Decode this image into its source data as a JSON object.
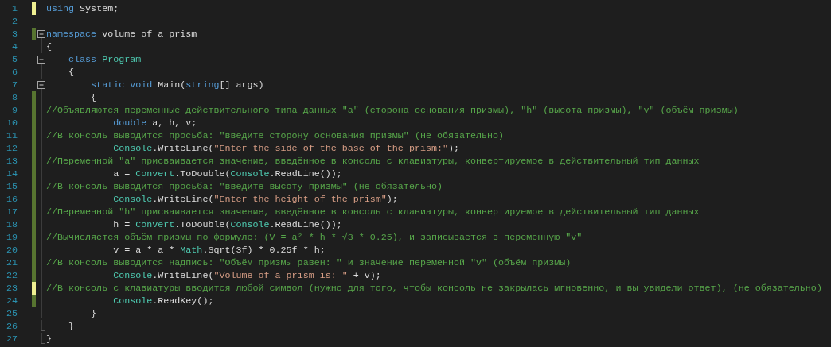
{
  "editor": {
    "lines": [
      {
        "number": "1",
        "color": "#efef91",
        "fold_start": false,
        "fold_end": false,
        "tokens": [
          {
            "kind": "keyword",
            "text": "using"
          },
          {
            "kind": "plain",
            "text": " System;"
          }
        ]
      },
      {
        "number": "2",
        "fold_start": false,
        "fold_end": false
      },
      {
        "number": "3",
        "color": "#577430",
        "fold_start": true,
        "fold_end": false,
        "tokens": [
          {
            "kind": "keyword",
            "text": "namespace"
          },
          {
            "kind": "plain",
            "text": " volume_of_a_prism"
          }
        ]
      },
      {
        "number": "4",
        "fold_start": false,
        "fold_end": false,
        "tokens": [
          {
            "kind": "plain",
            "text": "{"
          }
        ]
      },
      {
        "number": "5",
        "fold_start": true,
        "fold_end": false,
        "tokens": [
          {
            "kind": "keyword",
            "text": "    class "
          },
          {
            "kind": "type",
            "text": "Program"
          }
        ]
      },
      {
        "number": "6",
        "fold_start": false,
        "fold_end": false,
        "tokens": [
          {
            "kind": "plain",
            "text": "    {"
          }
        ]
      },
      {
        "number": "7",
        "fold_start": true,
        "fold_end": false,
        "tokens": [
          {
            "kind": "keyword",
            "text": "        static void"
          },
          {
            "kind": "plain",
            "text": " Main("
          },
          {
            "kind": "keyword",
            "text": "string"
          },
          {
            "kind": "plain",
            "text": "[] args)"
          }
        ]
      },
      {
        "number": "8",
        "color": "#577430",
        "fold_start": false,
        "fold_end": false,
        "tokens": [
          {
            "kind": "plain",
            "text": "        {"
          }
        ]
      },
      {
        "number": "9",
        "color": "#577430",
        "fold_start": false,
        "fold_end": false,
        "tokens": [
          {
            "kind": "comment",
            "text": "//Объявляются переменные действительного типа данных \"a\" (сторона основания призмы), \"h\" (высота призмы), \"v\" (объём призмы)"
          }
        ]
      },
      {
        "number": "10",
        "color": "#577430",
        "fold_start": false,
        "fold_end": false,
        "tokens": [
          {
            "kind": "keyword",
            "text": "            double"
          },
          {
            "kind": "plain",
            "text": " a, h, v;"
          }
        ]
      },
      {
        "number": "11",
        "color": "#577430",
        "fold_start": false,
        "fold_end": false,
        "tokens": [
          {
            "kind": "comment",
            "text": "//В консоль выводится просьба: \"введите сторону основания призмы\" (не обязательно)"
          }
        ]
      },
      {
        "number": "12",
        "color": "#577430",
        "fold_start": false,
        "fold_end": false,
        "tokens": [
          {
            "kind": "type",
            "text": "            Console"
          },
          {
            "kind": "plain",
            "text": ".WriteLine("
          },
          {
            "kind": "string",
            "text": "\"Enter the side of the base of the prism:\""
          },
          {
            "kind": "plain",
            "text": ");"
          }
        ]
      },
      {
        "number": "13",
        "color": "#577430",
        "fold_start": false,
        "fold_end": false,
        "tokens": [
          {
            "kind": "comment",
            "text": "//Переменной \"a\" присваивается значение, введённое в консоль с клавиатуры, конвертируемое в действительный тип данных"
          }
        ]
      },
      {
        "number": "14",
        "color": "#577430",
        "fold_start": false,
        "fold_end": false,
        "tokens": [
          {
            "kind": "plain",
            "text": "            a = "
          },
          {
            "kind": "type",
            "text": "Convert"
          },
          {
            "kind": "plain",
            "text": ".ToDouble("
          },
          {
            "kind": "type",
            "text": "Console"
          },
          {
            "kind": "plain",
            "text": ".ReadLine());"
          }
        ]
      },
      {
        "number": "15",
        "color": "#577430",
        "fold_start": false,
        "fold_end": false,
        "tokens": [
          {
            "kind": "comment",
            "text": "//В консоль выводится просьба: \"введите высоту призмы\" (не обязательно)"
          }
        ]
      },
      {
        "number": "16",
        "color": "#577430",
        "fold_start": false,
        "fold_end": false,
        "tokens": [
          {
            "kind": "type",
            "text": "            Console"
          },
          {
            "kind": "plain",
            "text": ".WriteLine("
          },
          {
            "kind": "string",
            "text": "\"Enter the height of the prism\""
          },
          {
            "kind": "plain",
            "text": ");"
          }
        ]
      },
      {
        "number": "17",
        "color": "#577430",
        "fold_start": false,
        "fold_end": false,
        "tokens": [
          {
            "kind": "comment",
            "text": "//Переменной \"h\" присваивается значение, введённое в консоль с клавиатуры, конвертируемое в действительный тип данных"
          }
        ]
      },
      {
        "number": "18",
        "color": "#577430",
        "fold_start": false,
        "fold_end": false,
        "tokens": [
          {
            "kind": "plain",
            "text": "            h = "
          },
          {
            "kind": "type",
            "text": "Convert"
          },
          {
            "kind": "plain",
            "text": ".ToDouble("
          },
          {
            "kind": "type",
            "text": "Console"
          },
          {
            "kind": "plain",
            "text": ".ReadLine());"
          }
        ]
      },
      {
        "number": "19",
        "color": "#577430",
        "fold_start": false,
        "fold_end": false,
        "tokens": [
          {
            "kind": "comment",
            "text": "//Вычисляется объём призмы по формуле: (V = a² * h * √3 * 0.25), и записывается в переменную \"v\""
          }
        ]
      },
      {
        "number": "20",
        "color": "#577430",
        "fold_start": false,
        "fold_end": false,
        "tokens": [
          {
            "kind": "plain",
            "text": "            v = a * a * "
          },
          {
            "kind": "type",
            "text": "Math"
          },
          {
            "kind": "plain",
            "text": ".Sqrt(3f) * 0.25f * h;"
          }
        ]
      },
      {
        "number": "21",
        "color": "#577430",
        "fold_start": false,
        "fold_end": false,
        "tokens": [
          {
            "kind": "comment",
            "text": "//В консоль выводится надпись: \"Объём призмы равен: \" и значение переменной \"v\" (объём призмы)"
          }
        ]
      },
      {
        "number": "22",
        "color": "#577430",
        "fold_start": false,
        "fold_end": false,
        "tokens": [
          {
            "kind": "type",
            "text": "            Console"
          },
          {
            "kind": "plain",
            "text": ".WriteLine("
          },
          {
            "kind": "string",
            "text": "\"Volume of a prism is: \""
          },
          {
            "kind": "plain",
            "text": " + v);"
          }
        ]
      },
      {
        "number": "23",
        "color": "#efef91",
        "fold_start": false,
        "fold_end": false,
        "tokens": [
          {
            "kind": "comment",
            "text": "//В консоль с клавиатуры вводится любой символ (нужно для того, чтобы консоль не закрылась мгновенно, и вы увидели ответ), (не обязательно)"
          }
        ]
      },
      {
        "number": "24",
        "color": "#577430",
        "fold_start": false,
        "fold_end": false,
        "tokens": [
          {
            "kind": "type",
            "text": "            Console"
          },
          {
            "kind": "plain",
            "text": ".ReadKey();"
          }
        ]
      },
      {
        "number": "25",
        "fold_start": false,
        "fold_end": true,
        "tokens": [
          {
            "kind": "plain",
            "text": "        }"
          }
        ]
      },
      {
        "number": "26",
        "fold_start": false,
        "fold_end": true,
        "tokens": [
          {
            "kind": "plain",
            "text": "    }"
          }
        ]
      },
      {
        "number": "27",
        "fold_start": false,
        "fold_end": true,
        "tokens": [
          {
            "kind": "plain",
            "text": "}"
          }
        ]
      }
    ]
  }
}
